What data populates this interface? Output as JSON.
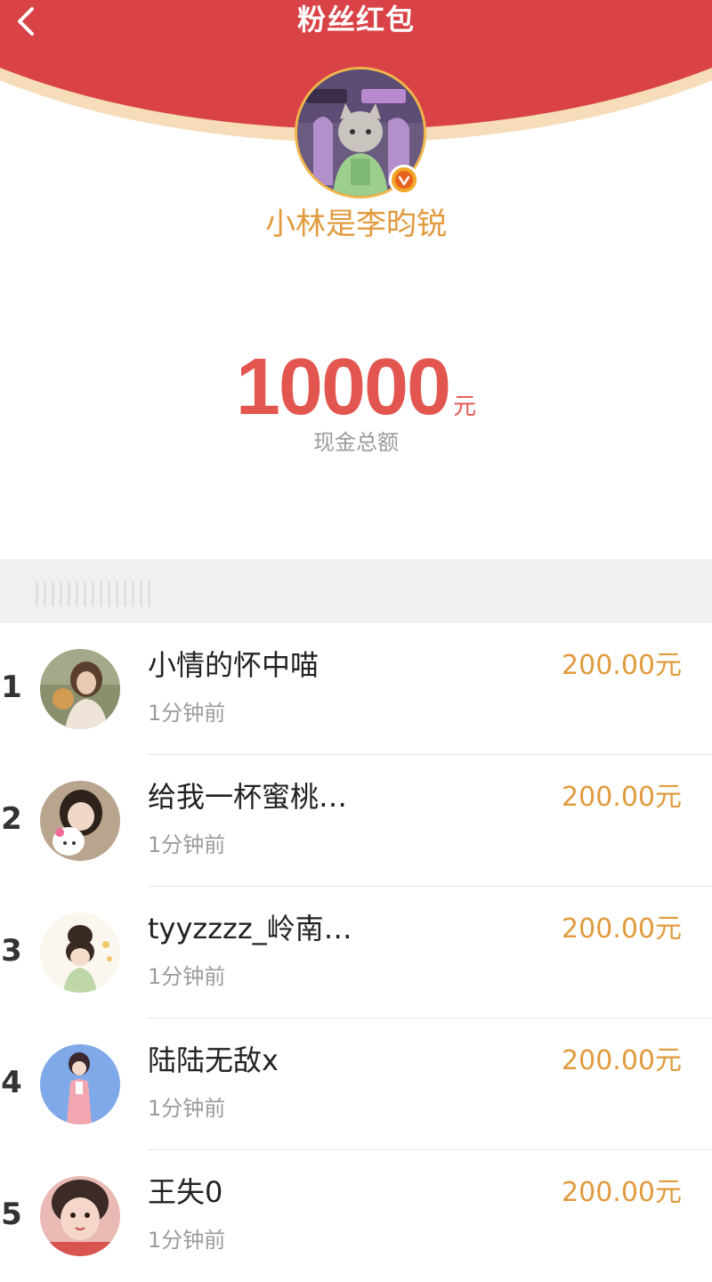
{
  "header": {
    "title": "粉丝红包",
    "back_icon": "chevron-left-icon",
    "color": "#d94347",
    "curve_color": "#f6dcb8"
  },
  "sender": {
    "name": "小林是李昀锐",
    "verified_icon": "verified-badge-icon",
    "name_color": "#e19a3d"
  },
  "total": {
    "amount": "10000",
    "unit": "元",
    "label": "现金总额",
    "color": "#e2564f"
  },
  "recipients": [
    {
      "rank": "1",
      "name": "小情的怀中喵",
      "time": "1分钟前",
      "amount": "200.00元"
    },
    {
      "rank": "2",
      "name": "给我一杯蜜桃…",
      "time": "1分钟前",
      "amount": "200.00元"
    },
    {
      "rank": "3",
      "name": "tyyzzzz_岭南…",
      "time": "1分钟前",
      "amount": "200.00元"
    },
    {
      "rank": "4",
      "name": "陆陆无敌x",
      "time": "1分钟前",
      "amount": "200.00元"
    },
    {
      "rank": "5",
      "name": "王失0",
      "time": "1分钟前",
      "amount": "200.00元"
    }
  ],
  "amount_color": "#e19a3d"
}
